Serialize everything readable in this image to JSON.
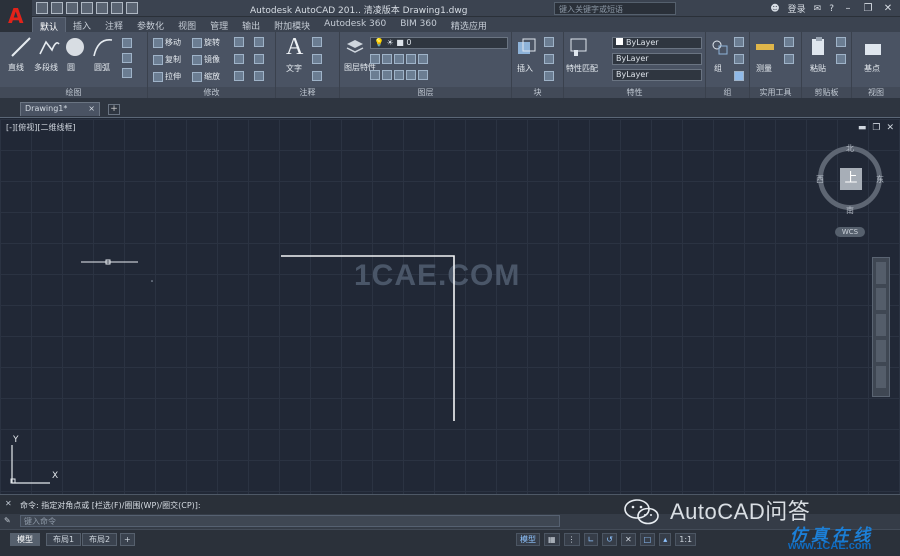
{
  "titlebar": {
    "title": "Autodesk AutoCAD 201..   清凌版本   Drawing1.dwg",
    "search_placeholder": "键入关键字或短语",
    "user": "登录",
    "help": "?"
  },
  "ribbon_tabs": [
    "默认",
    "插入",
    "注释",
    "参数化",
    "视图",
    "管理",
    "输出",
    "附加模块",
    "Autodesk 360",
    "BIM 360",
    "精选应用"
  ],
  "ribbon": {
    "draw": {
      "title": "绘图",
      "line": "直线",
      "polyline": "多段线",
      "circle": "圆",
      "arc": "圆弧"
    },
    "modify": {
      "title": "修改",
      "move": "移动",
      "rotate": "旋转",
      "copy": "复制",
      "mirror": "镜像",
      "stretch": "拉伸",
      "scale": "缩放"
    },
    "annotation": {
      "title": "注释",
      "text": "文字"
    },
    "layers": {
      "title": "图层",
      "properties": "图层特性"
    },
    "block": {
      "title": "块",
      "insert": "插入"
    },
    "properties": {
      "title": "特性",
      "match": "特性匹配",
      "color": "ByLayer",
      "linetype": "ByLayer",
      "lineweight": "ByLayer"
    },
    "groups": {
      "title": "组",
      "group": "组"
    },
    "utilities": {
      "title": "实用工具",
      "measure": "测量"
    },
    "clipboard": {
      "title": "剪贴板",
      "paste": "粘贴"
    },
    "view": {
      "title": "视图",
      "base": "基点"
    }
  },
  "doc_tab": {
    "name": "Drawing1*",
    "close": "×",
    "new": "+"
  },
  "viewport": {
    "label": "[-][俯视][二维线框]",
    "viewcube": {
      "face": "上",
      "north": "北",
      "south": "南",
      "east": "东",
      "west": "西",
      "wcs": "WCS"
    },
    "ucs_x": "X",
    "ucs_y": "Y",
    "watermark": "1CAE.COM"
  },
  "command": {
    "history": "命令: 指定对角点或 [栏选(F)/圈围(WP)/圈交(CP)]:",
    "input_placeholder": "键入命令"
  },
  "statusbar": {
    "layouts": [
      "模型",
      "布局1",
      "布局2"
    ],
    "add_layout": "+",
    "model_label": "模型",
    "scale": "1:1"
  },
  "overlay": {
    "brand": "AutoCAD问答",
    "site_cn": "仿真在线",
    "site_url": "www.1CAE.com"
  }
}
